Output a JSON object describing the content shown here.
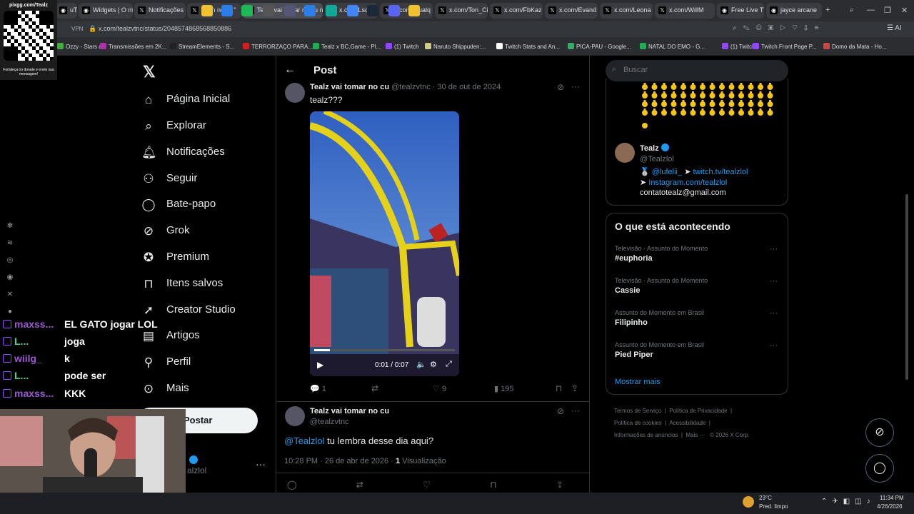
{
  "browser": {
    "tabs": [
      {
        "label": "uTube"
      },
      {
        "label": "Widgets | O m"
      },
      {
        "label": "Notificações"
      },
      {
        "label": "Tonn no X: \""
      },
      {
        "label": "Tealz vai tomar no cu no"
      },
      {
        "label": "x.com/Lsoezz"
      },
      {
        "label": "x.com/atualq"
      },
      {
        "label": "x.com/Ton_Ci"
      },
      {
        "label": "x.com/FbKaz"
      },
      {
        "label": "x.com/Evand"
      },
      {
        "label": "x.com/Leona"
      },
      {
        "label": "x.com/WillM"
      },
      {
        "label": "Free Live TV"
      },
      {
        "label": "jayce arcane"
      }
    ],
    "vpn_label": "VPN",
    "url": "x.com/tealzvtnc/status/2048574868568850886",
    "bookmarks": [
      "Ozzy - Stars a...",
      "Transmissões em 2K...",
      "StreamElements - S...",
      "TERRORZAÇO PARA...",
      "Tealz x BC.Game - Pl...",
      "(1) Twitch",
      "Naruto Shippuden:...",
      "Twitch Stats and An...",
      "PICA-PAU - Google...",
      "NATAL DO EMO - G...",
      "(1) Twitch",
      "Twitch Front Page P...",
      "Domo da Mata - Ho..."
    ]
  },
  "qr": {
    "title": "pixgg.com/Tealz",
    "caption": "Fortaleça no donate e envie sua mensagem!"
  },
  "nav": {
    "items": [
      {
        "label": "Página Inicial",
        "icon": "home-icon"
      },
      {
        "label": "Explorar",
        "icon": "search-icon"
      },
      {
        "label": "Notificações",
        "icon": "bell-icon"
      },
      {
        "label": "Seguir",
        "icon": "follow-icon"
      },
      {
        "label": "Bate-papo",
        "icon": "chat-icon"
      },
      {
        "label": "Grok",
        "icon": "grok-icon"
      },
      {
        "label": "Premium",
        "icon": "premium-icon"
      },
      {
        "label": "Itens salvos",
        "icon": "bookmark-icon"
      },
      {
        "label": "Creator Studio",
        "icon": "rocket-icon"
      },
      {
        "label": "Artigos",
        "icon": "article-icon"
      },
      {
        "label": "Perfil",
        "icon": "person-icon"
      },
      {
        "label": "Mais",
        "icon": "more-icon"
      }
    ],
    "post_button": "Postar",
    "account_handle": "alzlol"
  },
  "post": {
    "header_title": "Post",
    "quoted": {
      "name": "Tealz vai tomar no cu",
      "handle": "@tealzvtnc",
      "sep": "·",
      "date": "30 de out de 2024",
      "text": "tealz???",
      "video_time": "0:01 / 0:07",
      "replies": "1",
      "likes": "9",
      "views": "195"
    },
    "main": {
      "name": "Tealz vai tomar no cu",
      "handle": "@tealzvtnc",
      "mention": "@Tealzlol",
      "text": " tu lembra desse dia aqui?",
      "timestamp": "10:28 PM · 26 de abr de 2026 ·",
      "views_count": "1",
      "views_label": " Visualização"
    }
  },
  "right": {
    "search_placeholder": "Buscar",
    "profile": {
      "name": "Tealz",
      "handle": "@Tealzlol",
      "bio_line1_mention": "@lufelii_",
      "bio_line1_link": "twitch.tv/tealzlol",
      "bio_line2_link": "Instagram.com/tealzlol",
      "email": "contatotealz@gmail.com"
    },
    "trends_title": "O que está acontecendo",
    "trends": [
      {
        "meta": "Televisão · Assunto do Momento",
        "name": "#euphoria"
      },
      {
        "meta": "Televisão · Assunto do Momento",
        "name": "Cassie"
      },
      {
        "meta": "Assunto do Momento em Brasil",
        "name": "Filipinho"
      },
      {
        "meta": "Assunto do Momento em Brasil",
        "name": "Pied Piper"
      }
    ],
    "show_more": "Mostrar mais",
    "footer": {
      "terms": "Termos de Serviço",
      "privacy": "Política de Privacidade",
      "cookies": "Política de cookies",
      "accessibility": "Acessibilidade",
      "ads": "Informações de anúncios",
      "more": "Mais ···",
      "copyright": "© 2026 X Corp."
    }
  },
  "chat": [
    {
      "user": "maxss...",
      "msg": "EL GATO jogar LOL",
      "color": "#9b59d0"
    },
    {
      "user": "L...",
      "msg": "joga",
      "color": "#3fd8a8"
    },
    {
      "user": "wiilg_",
      "msg": "k",
      "color": "#9b59d0"
    },
    {
      "user": "L...",
      "msg": "pode ser",
      "color": "#3fd8a8"
    },
    {
      "user": "maxss...",
      "msg": "KKK",
      "color": "#9b59d0"
    }
  ],
  "taskbar": {
    "temp": "23°C",
    "weather": "Pred. limpo",
    "time": "11:34 PM",
    "date": "4/26/2026"
  },
  "colors": {
    "accent": "#1d9bf0",
    "bg": "#000000",
    "border": "#2f3336"
  }
}
